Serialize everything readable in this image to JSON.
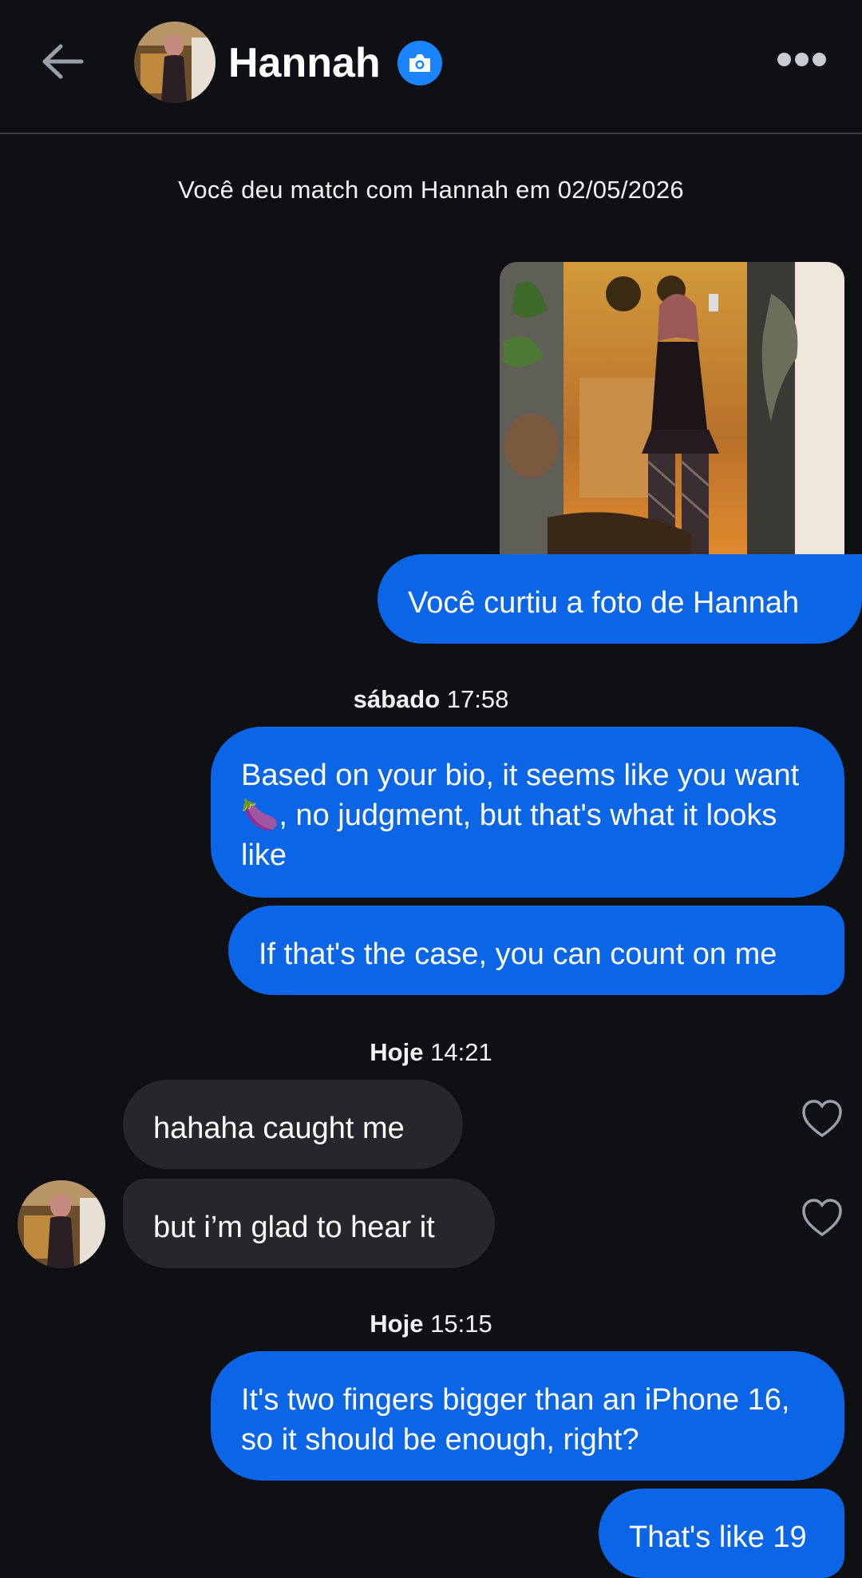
{
  "header": {
    "name": "Hannah",
    "back_icon": "back-arrow-icon",
    "badge_icon": "camera-icon",
    "more_icon": "more-dots-icon"
  },
  "system": {
    "match_note": "Você deu match com Hannah em 02/05/2026"
  },
  "photo_like": {
    "caption": "Você curtiu a foto de Hannah"
  },
  "timestamps": [
    {
      "day": "sábado",
      "time": "17:58"
    },
    {
      "day": "Hoje",
      "time": "14:21"
    },
    {
      "day": "Hoje",
      "time": "15:15"
    }
  ],
  "messages": {
    "m1": "Based on your bio, it seems like you want 🍆, no judgment, but that's what it looks like",
    "m2": "If that's the case, you can count on me",
    "m3": "hahaha caught me",
    "m4": "but i’m glad to hear it",
    "m5": "It's two fingers bigger than an iPhone 16, so it should be enough, right?",
    "m6": "That's like 19"
  },
  "colors": {
    "background": "#0e1014",
    "outgoing_bubble": "#0a66e6",
    "incoming_bubble": "#25272c",
    "badge": "#1b84ff"
  }
}
